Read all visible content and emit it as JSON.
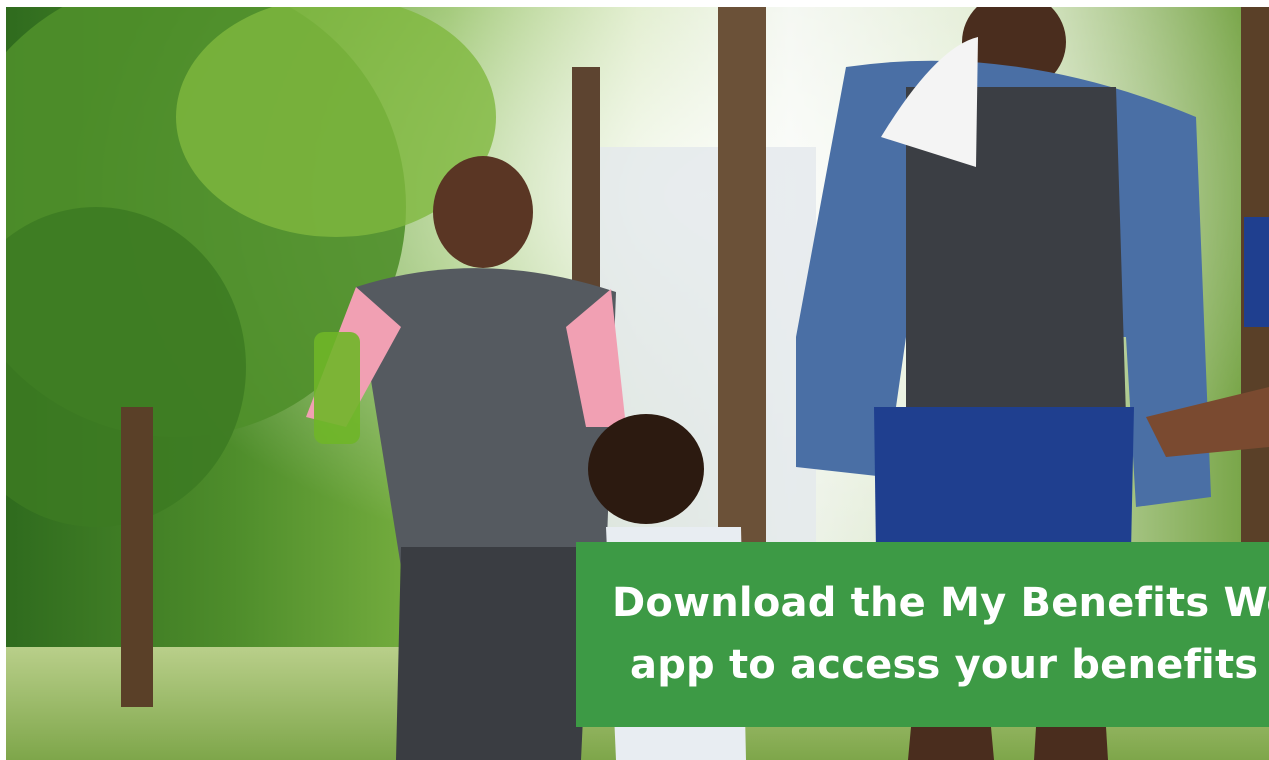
{
  "banner": {
    "line1": "Download the My Benefits Work m",
    "line2": "app to access your benefits on th"
  },
  "colors": {
    "banner_background": "#3d9a45",
    "banner_text": "#ffffff"
  },
  "hero_image": {
    "icon": "family-walking-photo"
  }
}
